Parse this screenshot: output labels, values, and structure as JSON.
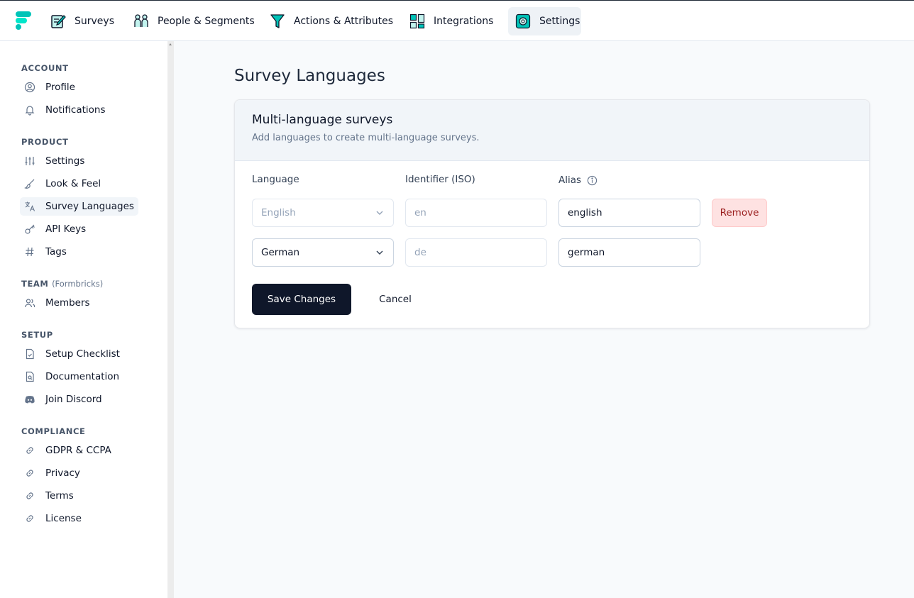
{
  "topnav": {
    "items": [
      {
        "label": "Surveys",
        "icon": "survey-edit-icon"
      },
      {
        "label": "People & Segments",
        "icon": "people-icon"
      },
      {
        "label": "Actions & Attributes",
        "icon": "filter-funnel-icon"
      },
      {
        "label": "Integrations",
        "icon": "integrations-grid-icon"
      },
      {
        "label": "Settings",
        "icon": "settings-gear-icon"
      }
    ],
    "active": "Settings"
  },
  "sidebar": {
    "sections": [
      {
        "title": "ACCOUNT",
        "items": [
          "Profile",
          "Notifications"
        ]
      },
      {
        "title": "PRODUCT",
        "items": [
          "Settings",
          "Look & Feel",
          "Survey Languages",
          "API Keys",
          "Tags"
        ]
      },
      {
        "title": "TEAM",
        "subtitle": "(Formbricks)",
        "items": [
          "Members"
        ]
      },
      {
        "title": "SETUP",
        "items": [
          "Setup Checklist",
          "Documentation",
          "Join Discord"
        ]
      },
      {
        "title": "COMPLIANCE",
        "items": [
          "GDPR & CCPA",
          "Privacy",
          "Terms",
          "License"
        ]
      }
    ],
    "active": "Survey Languages"
  },
  "main": {
    "title": "Survey Languages",
    "card": {
      "title": "Multi-language surveys",
      "description": "Add languages to create multi-language surveys.",
      "columns": {
        "language": "Language",
        "identifier": "Identifier (ISO)",
        "alias": "Alias"
      },
      "rows": [
        {
          "language": "English",
          "identifier": "en",
          "alias": "english",
          "action": "Remove"
        },
        {
          "language": "German",
          "identifier": "de",
          "alias": "german"
        }
      ],
      "save_label": "Save Changes",
      "cancel_label": "Cancel"
    }
  },
  "colors": {
    "brand": "#00C4B8",
    "primary_button": "#0f172a",
    "remove_bg": "#fee2e2",
    "remove_text": "#991b1b"
  }
}
